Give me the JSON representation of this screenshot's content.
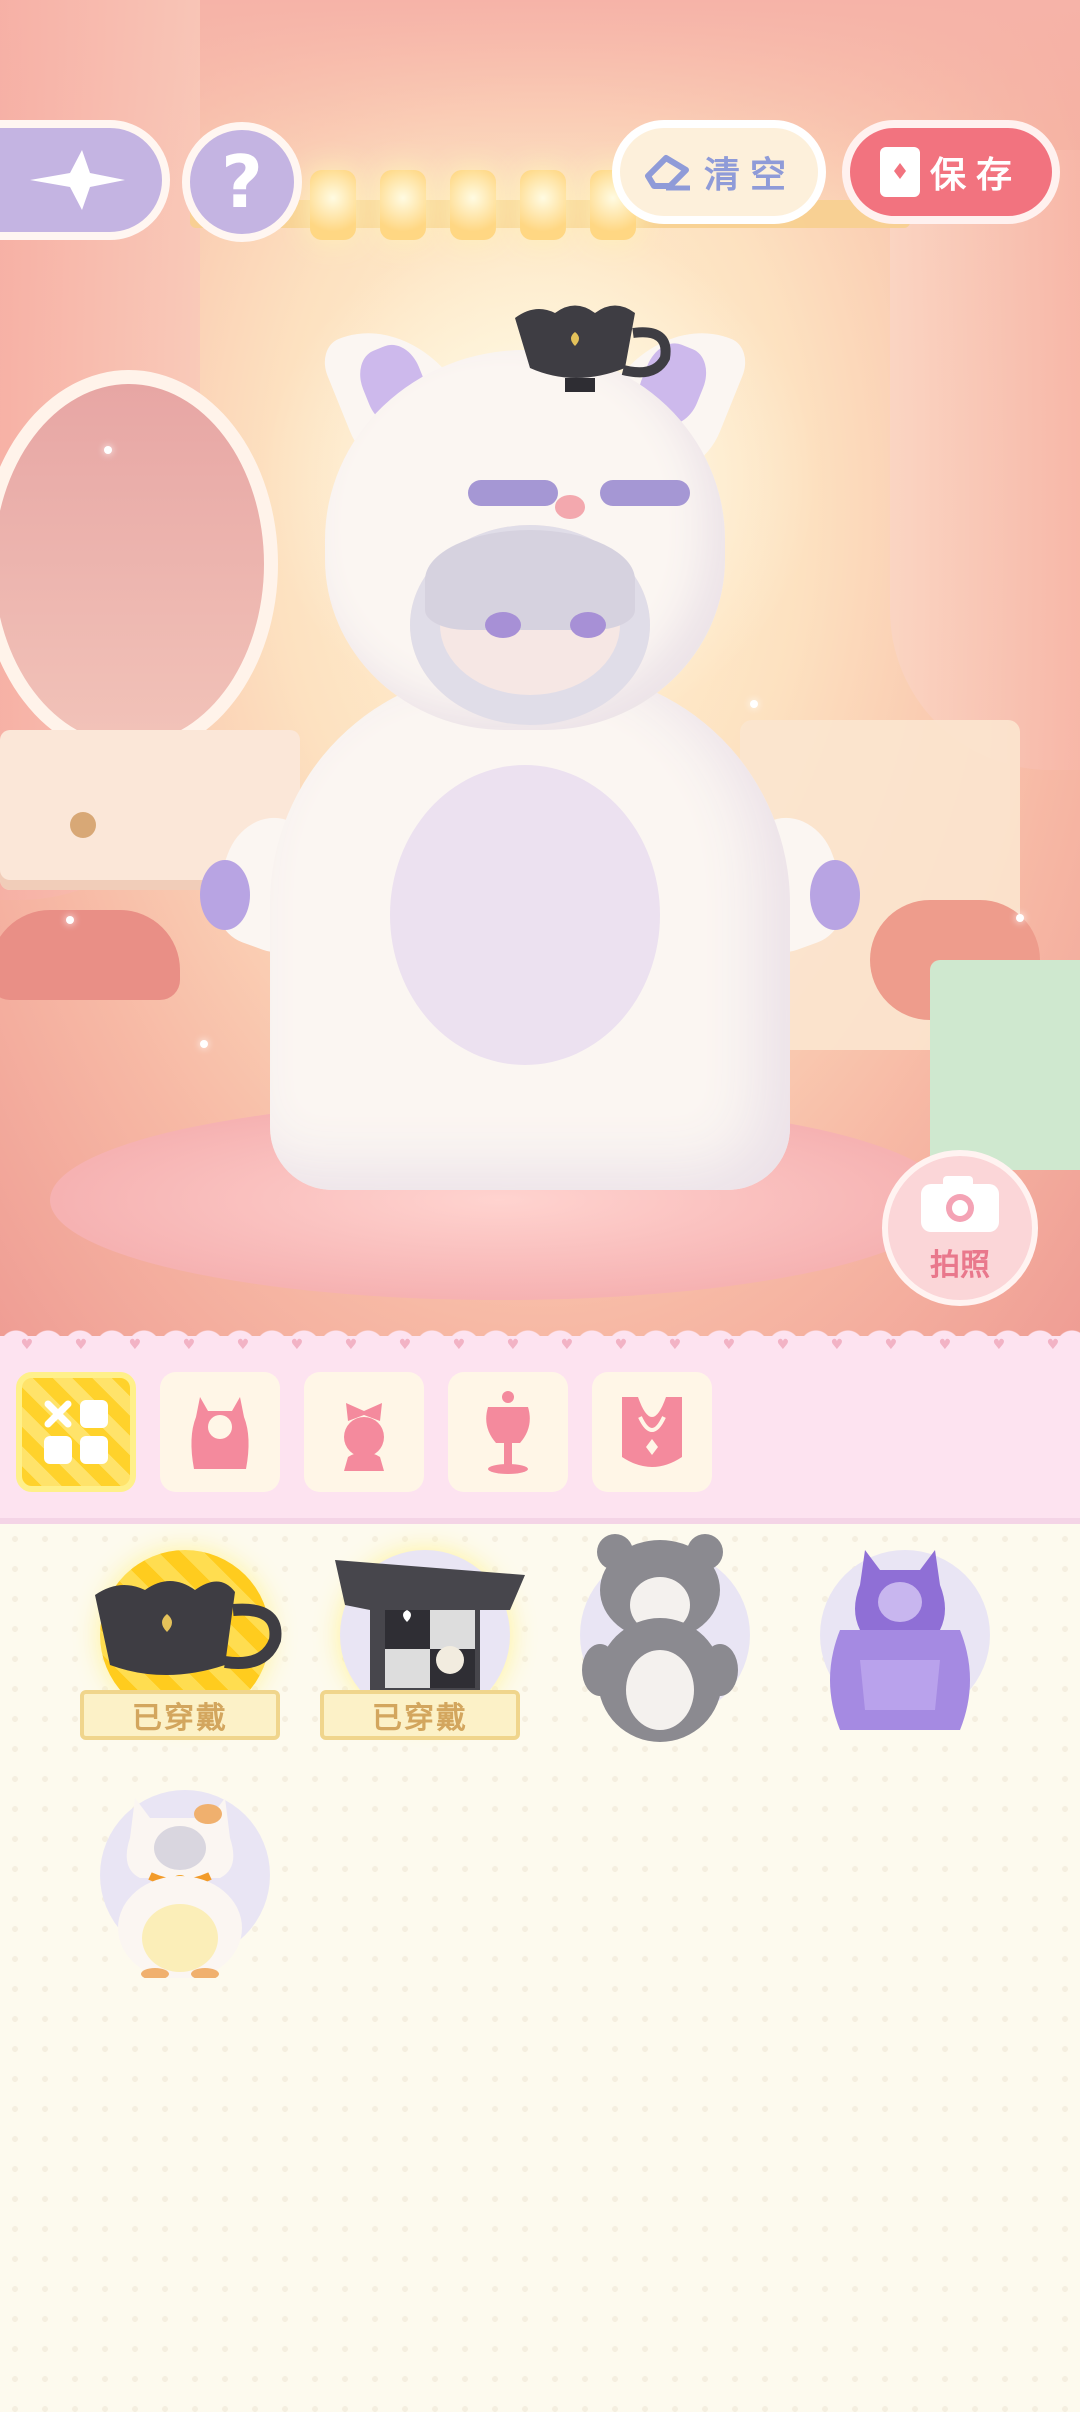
{
  "header": {
    "clear_label": "清空",
    "save_label": "保存",
    "help_symbol": "?"
  },
  "scene": {
    "photo_label": "拍照"
  },
  "categories": [
    {
      "icon": "all-items-grid-icon",
      "active": true
    },
    {
      "icon": "hood-costume-icon",
      "active": false
    },
    {
      "icon": "hat-bow-icon",
      "active": false
    },
    {
      "icon": "mannequin-icon",
      "active": false
    },
    {
      "icon": "necklace-icon",
      "active": false
    }
  ],
  "items": [
    {
      "icon": "teacup-hat-icon",
      "equipped": true,
      "label": "已穿戴"
    },
    {
      "icon": "card-suit-outfit-icon",
      "equipped": true,
      "label": "已穿戴"
    },
    {
      "icon": "gray-bear-costume-icon",
      "equipped": false
    },
    {
      "icon": "purple-cat-hoodie-icon",
      "equipped": false
    },
    {
      "icon": "calico-cat-costume-icon",
      "equipped": false
    }
  ],
  "colors": {
    "accent_pink": "#f2737f",
    "accent_lavender": "#c4b4e2",
    "equipped_yellow": "#ffd22b",
    "tab_bar_pink": "#fde3f0"
  }
}
